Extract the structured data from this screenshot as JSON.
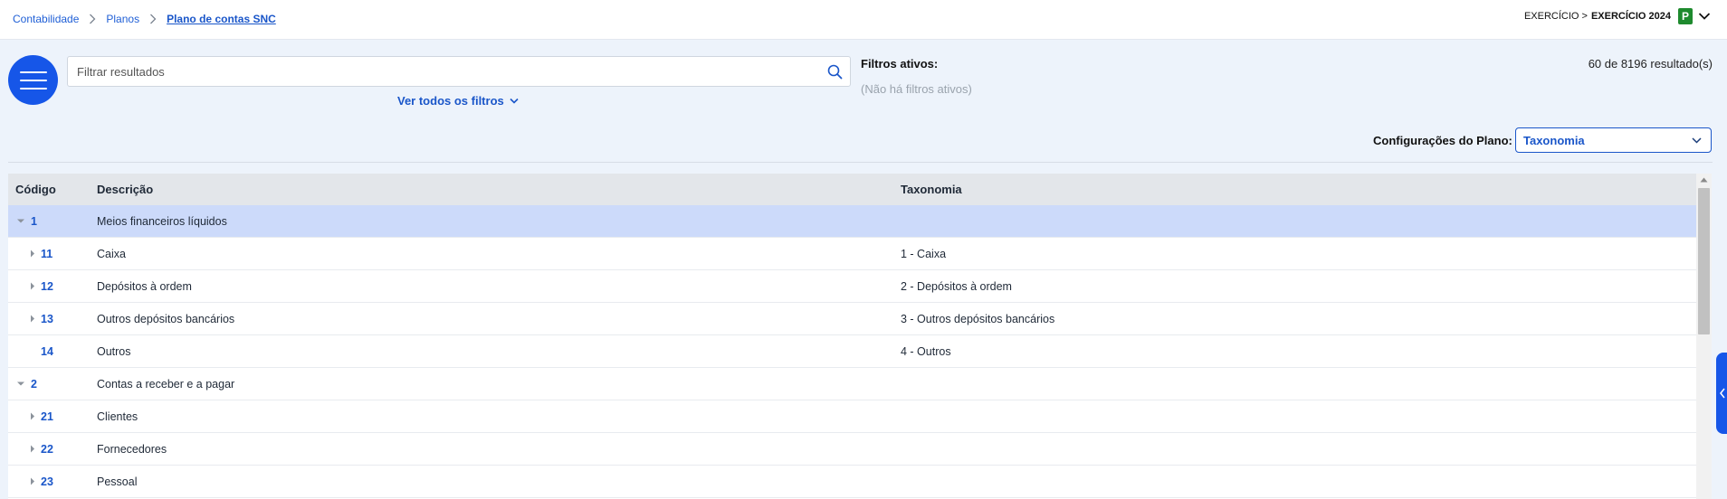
{
  "breadcrumb": {
    "items": [
      "Contabilidade",
      "Planos",
      "Plano de contas SNC"
    ]
  },
  "exercise": {
    "prefix": "EXERCÍCIO >",
    "label": "EXERCÍCIO 2024",
    "badge": "P",
    "badge_color": "#1e8a2e"
  },
  "toolbar": {
    "menu_icon": "hamburger-icon",
    "search_placeholder": "Filtrar resultados",
    "search_value": "",
    "all_filters_label": "Ver todos os filtros"
  },
  "filters": {
    "title": "Filtros ativos:",
    "none_text": "(Não há filtros ativos)"
  },
  "results": {
    "count_text": "60 de 8196 resultado(s)"
  },
  "config": {
    "label": "Configurações do Plano:",
    "selected": "Taxonomia"
  },
  "table": {
    "headers": {
      "code": "Código",
      "description": "Descrição",
      "taxonomy": "Taxonomia"
    },
    "rows": [
      {
        "level": 1,
        "expander": "expanded",
        "code": "1",
        "description": "Meios financeiros líquidos",
        "taxonomy": "",
        "selected": true
      },
      {
        "level": 2,
        "expander": "collapsed",
        "code": "11",
        "description": "Caixa",
        "taxonomy": "1 - Caixa",
        "selected": false
      },
      {
        "level": 2,
        "expander": "collapsed",
        "code": "12",
        "description": "Depósitos à ordem",
        "taxonomy": "2 - Depósitos à ordem",
        "selected": false
      },
      {
        "level": 2,
        "expander": "collapsed",
        "code": "13",
        "description": "Outros depósitos bancários",
        "taxonomy": "3 - Outros depósitos bancários",
        "selected": false
      },
      {
        "level": 2,
        "expander": "none",
        "code": "14",
        "description": "Outros",
        "taxonomy": "4 - Outros",
        "selected": false
      },
      {
        "level": 1,
        "expander": "expanded",
        "code": "2",
        "description": "Contas a receber e a pagar",
        "taxonomy": "",
        "selected": false
      },
      {
        "level": 2,
        "expander": "collapsed",
        "code": "21",
        "description": "Clientes",
        "taxonomy": "",
        "selected": false
      },
      {
        "level": 2,
        "expander": "collapsed",
        "code": "22",
        "description": "Fornecedores",
        "taxonomy": "",
        "selected": false
      },
      {
        "level": 2,
        "expander": "collapsed",
        "code": "23",
        "description": "Pessoal",
        "taxonomy": "",
        "selected": false
      }
    ]
  },
  "colors": {
    "accent": "#1656e8",
    "link": "#1a56c9",
    "selected_row": "#ccdafa",
    "header_bg": "#e3e6ea",
    "page_bg": "#edf3fb"
  }
}
